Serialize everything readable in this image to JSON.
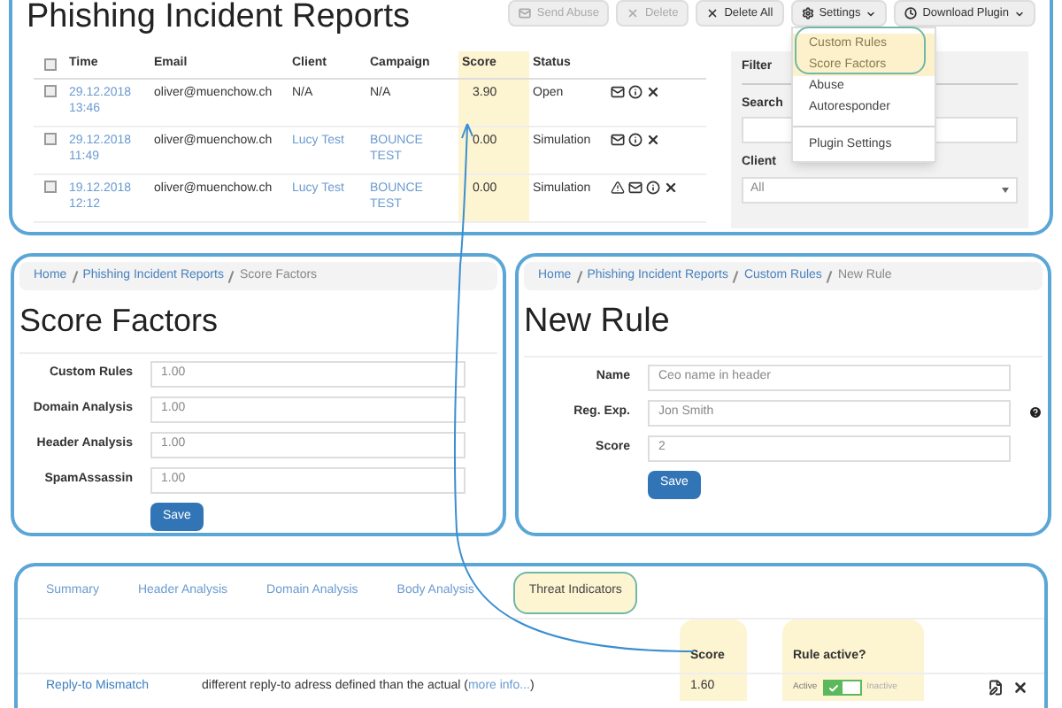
{
  "incidents": {
    "title": "Phishing Incident Reports",
    "actions": [
      {
        "label": "Send Abuse",
        "disabled": true,
        "caret": false
      },
      {
        "label": "Delete",
        "disabled": true,
        "caret": false
      },
      {
        "label": "Delete All",
        "disabled": false,
        "caret": false
      },
      {
        "label": "Settings",
        "disabled": false,
        "caret": true
      },
      {
        "label": "Download Plugin",
        "disabled": false,
        "caret": true
      }
    ],
    "select_all_checked": false,
    "columns": [
      {
        "label": "Time",
        "highlighted": false
      },
      {
        "label": "Email",
        "highlighted": false
      },
      {
        "label": "Client",
        "highlighted": false
      },
      {
        "label": "Campaign",
        "highlighted": false
      },
      {
        "label": "Score",
        "highlighted": true
      },
      {
        "label": "Status",
        "highlighted": false
      }
    ],
    "rows": [
      {
        "checked": false,
        "time": "29.12.2018 13:46",
        "email": "oliver@muenchow.ch",
        "client": "N/A",
        "campaign": "N/A",
        "score": "3.90",
        "status": "Open",
        "linked": false,
        "warning": false
      },
      {
        "checked": false,
        "time": "29.12.2018 11:49",
        "email": "oliver@muenchow.ch",
        "client": "Lucy Test",
        "campaign": "BOUNCE TEST",
        "score": "0.00",
        "status": "Simulation",
        "linked": true,
        "warning": false
      },
      {
        "checked": false,
        "time": "19.12.2018 12:12",
        "email": "oliver@muenchow.ch",
        "client": "Lucy Test",
        "campaign": "BOUNCE TEST",
        "score": "0.00",
        "status": "Simulation",
        "linked": true,
        "warning": true
      }
    ],
    "filter": {
      "title": "Filter",
      "search_label": "Search",
      "client_label": "Client",
      "client_value": "All"
    },
    "settings_menu": [
      {
        "label": "Custom Rules",
        "highlighted": true,
        "divider_before": false
      },
      {
        "label": "Score Factors",
        "highlighted": true,
        "divider_before": false
      },
      {
        "label": "Abuse",
        "highlighted": false,
        "divider_before": false
      },
      {
        "label": "Autoresponder",
        "highlighted": false,
        "divider_before": false
      },
      {
        "label": "Plugin Settings",
        "highlighted": false,
        "divider_before": true
      }
    ]
  },
  "score_factors": {
    "breadcrumb": [
      "Home",
      "Phishing Incident Reports",
      "Score Factors"
    ],
    "title": "Score Factors",
    "fields": [
      {
        "label": "Custom Rules",
        "value": "1.00"
      },
      {
        "label": "Domain Analysis",
        "value": "1.00"
      },
      {
        "label": "Header Analysis",
        "value": "1.00"
      },
      {
        "label": "SpamAssassin",
        "value": "1.00"
      }
    ],
    "save": "Save"
  },
  "new_rule": {
    "breadcrumb": [
      "Home",
      "Phishing Incident Reports",
      "Custom Rules",
      "New Rule"
    ],
    "title": "New Rule",
    "fields": [
      {
        "label": "Name",
        "value": "Ceo name in header",
        "help": false
      },
      {
        "label": "Reg. Exp.",
        "value": "Jon Smith",
        "help": true
      },
      {
        "label": "Score",
        "value": "2",
        "help": false
      }
    ],
    "save": "Save"
  },
  "analysis": {
    "tabs": [
      {
        "label": "Summary",
        "selected": false
      },
      {
        "label": "Header Analysis",
        "selected": false
      },
      {
        "label": "Domain Analysis",
        "selected": false
      },
      {
        "label": "Body Analysis",
        "selected": false
      },
      {
        "label": "Threat Indicators",
        "selected": true
      }
    ],
    "columns": [
      {
        "label": "Score",
        "highlighted": true
      },
      {
        "label": "Rule active?",
        "highlighted": true
      }
    ],
    "rows": [
      {
        "name": "Reply-to Mismatch",
        "description": "different reply-to adress defined than the actual (",
        "link": "more info...",
        "closing": ")",
        "score": "1.60",
        "active": true,
        "on_label": "Active",
        "off_label": "Inactive"
      }
    ]
  }
}
